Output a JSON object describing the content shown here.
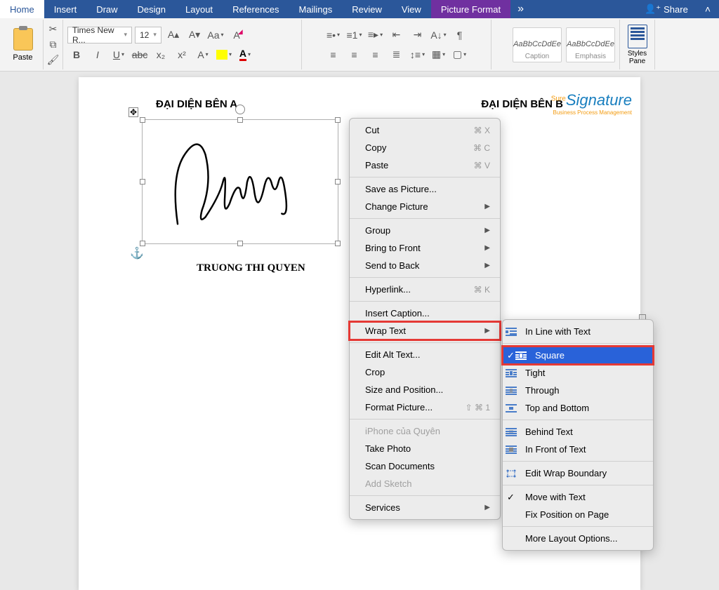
{
  "ribbon": {
    "tabs": [
      "Home",
      "Insert",
      "Draw",
      "Design",
      "Layout",
      "References",
      "Mailings",
      "Review",
      "View"
    ],
    "context_tab": "Picture Format",
    "share": "Share"
  },
  "toolbar": {
    "paste_label": "Paste",
    "font_name": "Times New R...",
    "font_size": "12",
    "styles": {
      "caption_preview": "AaBbCcDdEe",
      "caption_label": "Caption",
      "emphasis_preview": "AaBbCcDdEe",
      "emphasis_label": "Emphasis"
    },
    "styles_pane_label": "Styles\nPane"
  },
  "document": {
    "heading_a": "ĐẠI DIỆN BÊN A",
    "heading_b": "ĐẠI DIỆN BÊN B",
    "signer_name": "TRUONG THI QUYEN",
    "watermark_title": "Signature",
    "watermark_prefix": "Sure",
    "watermark_sub": "Business Process Management"
  },
  "context_menu": {
    "cut": "Cut",
    "cut_key": "⌘ X",
    "copy": "Copy",
    "copy_key": "⌘ C",
    "paste": "Paste",
    "paste_key": "⌘ V",
    "save_picture": "Save as Picture...",
    "change_picture": "Change Picture",
    "group": "Group",
    "bring_front": "Bring to Front",
    "send_back": "Send to Back",
    "hyperlink": "Hyperlink...",
    "hyperlink_key": "⌘ K",
    "insert_caption": "Insert Caption...",
    "wrap_text": "Wrap Text",
    "edit_alt": "Edit Alt Text...",
    "crop": "Crop",
    "size_position": "Size and Position...",
    "format_picture": "Format Picture...",
    "format_picture_key": "⇧ ⌘ 1",
    "iphone_item": "iPhone của Quyên",
    "take_photo": "Take Photo",
    "scan_docs": "Scan Documents",
    "add_sketch": "Add Sketch",
    "services": "Services"
  },
  "wrap_submenu": {
    "inline": "In Line with Text",
    "square": "Square",
    "tight": "Tight",
    "through": "Through",
    "top_bottom": "Top and Bottom",
    "behind": "Behind Text",
    "in_front": "In Front of Text",
    "edit_boundary": "Edit Wrap Boundary",
    "move_with": "Move with Text",
    "fix_position": "Fix Position on Page",
    "more_options": "More Layout Options..."
  }
}
